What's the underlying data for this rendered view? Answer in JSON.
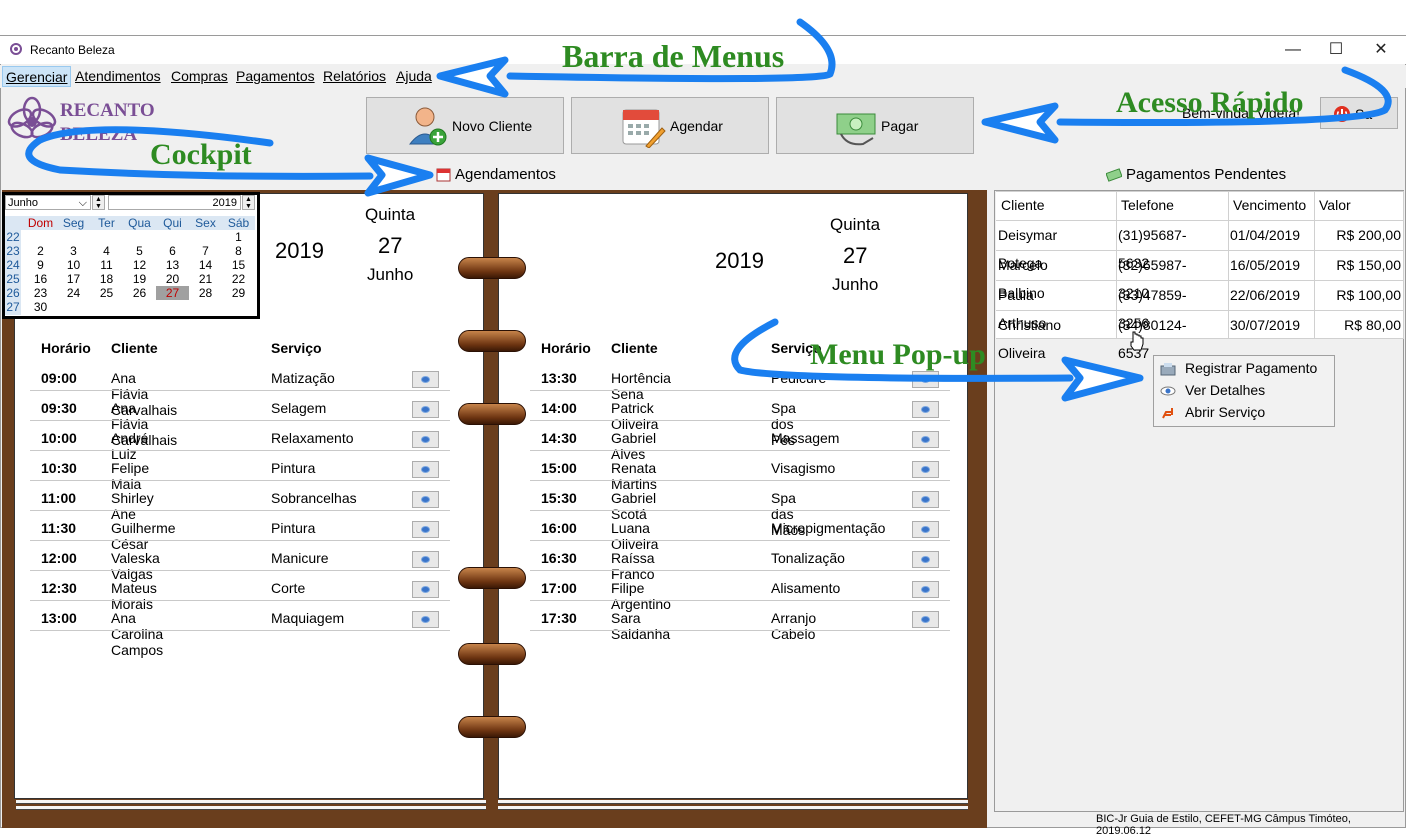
{
  "window": {
    "title": "Recanto Beleza",
    "controls": {
      "minimize": "—",
      "maximize": "☐",
      "close": "✕"
    }
  },
  "menu": [
    {
      "label": "Gerenciar",
      "active": true
    },
    {
      "label": "Atendimentos"
    },
    {
      "label": "Compras"
    },
    {
      "label": "Pagamentos"
    },
    {
      "label": "Relatórios"
    },
    {
      "label": "Ajuda"
    }
  ],
  "logo": {
    "line1": "RECANTO",
    "line2": "BELEZA",
    "color": "#7a4e95"
  },
  "toolbar": {
    "new_client": "Novo Cliente",
    "schedule": "Agendar",
    "pay": "Pagar",
    "welcome": "Bem-vinda, Vigeta!",
    "exit": "Sa"
  },
  "agenda": {
    "title": "Agendamentos",
    "calendar": {
      "month": "Junho",
      "year": "2019",
      "weekdays": [
        "Dom",
        "Seg",
        "Ter",
        "Qua",
        "Qui",
        "Sex",
        "Sáb"
      ],
      "weeks": [
        {
          "wk": "22",
          "days": [
            "",
            "",
            "",
            "",
            "",
            "",
            "1"
          ]
        },
        {
          "wk": "23",
          "days": [
            "2",
            "3",
            "4",
            "5",
            "6",
            "7",
            "8"
          ]
        },
        {
          "wk": "24",
          "days": [
            "9",
            "10",
            "11",
            "12",
            "13",
            "14",
            "15"
          ]
        },
        {
          "wk": "25",
          "days": [
            "16",
            "17",
            "18",
            "19",
            "20",
            "21",
            "22"
          ]
        },
        {
          "wk": "26",
          "days": [
            "23",
            "24",
            "25",
            "26",
            "27",
            "28",
            "29"
          ]
        },
        {
          "wk": "27",
          "days": [
            "30",
            "",
            "",
            "",
            "",
            "",
            ""
          ]
        }
      ],
      "selected": "27"
    },
    "left_page": {
      "year": "2019",
      "weekday": "Quinta",
      "day": "27",
      "month": "Junho"
    },
    "right_page": {
      "year": "2019",
      "weekday": "Quinta",
      "day": "27",
      "month": "Junho"
    },
    "headers": {
      "time": "Horário",
      "client": "Cliente",
      "service": "Serviço"
    },
    "left_rows": [
      {
        "time": "09:00",
        "client": "Ana Flávia Carvalhais",
        "service": "Matização"
      },
      {
        "time": "09:30",
        "client": "Ana Flávia Carvalhais",
        "service": "Selagem"
      },
      {
        "time": "10:00",
        "client": "André Luiz",
        "service": "Relaxamento"
      },
      {
        "time": "10:30",
        "client": "Felipe Maia",
        "service": "Pintura"
      },
      {
        "time": "11:00",
        "client": "Shirley Ane",
        "service": "Sobrancelhas"
      },
      {
        "time": "11:30",
        "client": "Guilherme César",
        "service": "Pintura"
      },
      {
        "time": "12:00",
        "client": "Valeska Valgas",
        "service": "Manicure"
      },
      {
        "time": "12:30",
        "client": "Mateus Morais",
        "service": "Corte"
      },
      {
        "time": "13:00",
        "client": "Ana Carolina Campos",
        "service": "Maquiagem"
      }
    ],
    "right_rows": [
      {
        "time": "13:30",
        "client": "Hortência Sena",
        "service": "Pedicure"
      },
      {
        "time": "14:00",
        "client": "Patrick Oliveira",
        "service": "Spa dos Pés"
      },
      {
        "time": "14:30",
        "client": "Gabriel Alves",
        "service": "Massagem"
      },
      {
        "time": "15:00",
        "client": "Renata Martins",
        "service": "Visagismo"
      },
      {
        "time": "15:30",
        "client": "Gabriel Scotá",
        "service": "Spa das Mãos"
      },
      {
        "time": "16:00",
        "client": "Luana Oliveira",
        "service": "Micropigmentação"
      },
      {
        "time": "16:30",
        "client": "Raíssa Franco",
        "service": "Tonalização"
      },
      {
        "time": "17:00",
        "client": "Filipe Argentino",
        "service": "Alisamento"
      },
      {
        "time": "17:30",
        "client": "Sara Saldanha",
        "service": "Arranjo Cabelo"
      }
    ]
  },
  "pending": {
    "title": "Pagamentos Pendentes",
    "columns": [
      "Cliente",
      "Telefone",
      "Vencimento",
      "Valor"
    ],
    "rows": [
      {
        "client": "Deisymar Botega",
        "phone": "(31)95687-5632",
        "due": "01/04/2019",
        "value": "R$ 200,00"
      },
      {
        "client": "Marcelo Balbino",
        "phone": "(32)65987-3210",
        "due": "16/05/2019",
        "value": "R$ 150,00"
      },
      {
        "client": "Paula Arthuso",
        "phone": "(33)47859-3256",
        "due": "22/06/2019",
        "value": "R$ 100,00"
      },
      {
        "client": "Christiano Oliveira",
        "phone": "(34)80124-6537",
        "due": "30/07/2019",
        "value": "R$ 80,00"
      }
    ]
  },
  "popup": [
    {
      "label": "Registrar Pagamento",
      "icon": "cash-register-icon"
    },
    {
      "label": "Ver Detalhes",
      "icon": "eye-icon"
    },
    {
      "label": "Abrir Serviço",
      "icon": "chair-icon"
    }
  ],
  "annotations": {
    "menus": "Barra de Menus",
    "quick": "Acesso Rápido",
    "cockpit": "Cockpit",
    "popup": "Menu Pop-up",
    "color": "#2e8b22",
    "arrow_color": "#1a7ff0"
  },
  "status": "BIC-Jr Guia de Estilo, CEFET-MG Câmpus Timóteo, 2019.06.12"
}
